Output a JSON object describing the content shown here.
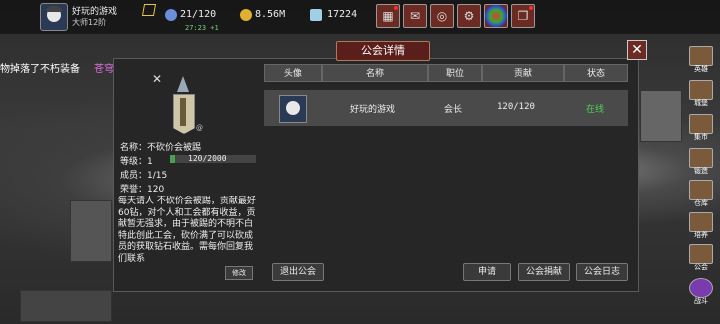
{
  "player": {
    "name": "好玩的游戏",
    "level": "大师12阶"
  },
  "resources": {
    "energy": "21/120",
    "energy_timer": "27:23 +1",
    "gold": "8.56M",
    "gems": "17224"
  },
  "toolbar": {
    "buttons": [
      {
        "icon": "shop-icon"
      },
      {
        "icon": "mail-icon"
      },
      {
        "icon": "gamepad-icon"
      },
      {
        "icon": "gear-icon"
      },
      {
        "icon": "color-wheel-icon"
      },
      {
        "icon": "quest-scroll-icon"
      }
    ]
  },
  "banner": {
    "text": "物掉落了不朽装备",
    "highlight": "苍穹护腕"
  },
  "sidebar": {
    "items": [
      {
        "label": "英雄"
      },
      {
        "label": "城堡"
      },
      {
        "label": "集市"
      },
      {
        "label": "锻造"
      },
      {
        "label": "仓库"
      },
      {
        "label": "培养"
      },
      {
        "label": "公会"
      },
      {
        "label": "战斗"
      }
    ]
  },
  "dialog": {
    "title": "公会详情",
    "guild": {
      "name": "名称：不砍价会被踢",
      "level_label": "等级：1",
      "xp": "120/2000",
      "xp_fraction": 0.06,
      "members": "成员：1/15",
      "honor": "荣誉：120"
    },
    "notice": "每天请人 不砍价会被踢，贡献最好60钻，对个人和工会都有收益，贡献暂无强求，由于被踢的不明不白特此创此工会，砍价满了可以砍成员的获取钻石收益。需每你回复我们联系",
    "notice_edit": "修改",
    "table": {
      "headers": [
        "头像",
        "名称",
        "职位",
        "贡献",
        "状态"
      ],
      "rows": [
        {
          "name": "好玩的游戏",
          "position": "会长",
          "contribution": "120/120",
          "status": "在线"
        }
      ]
    },
    "buttons": {
      "leave": "退出公会",
      "apply": "申请",
      "donate": "公会捐献",
      "log": "公会日志"
    }
  }
}
